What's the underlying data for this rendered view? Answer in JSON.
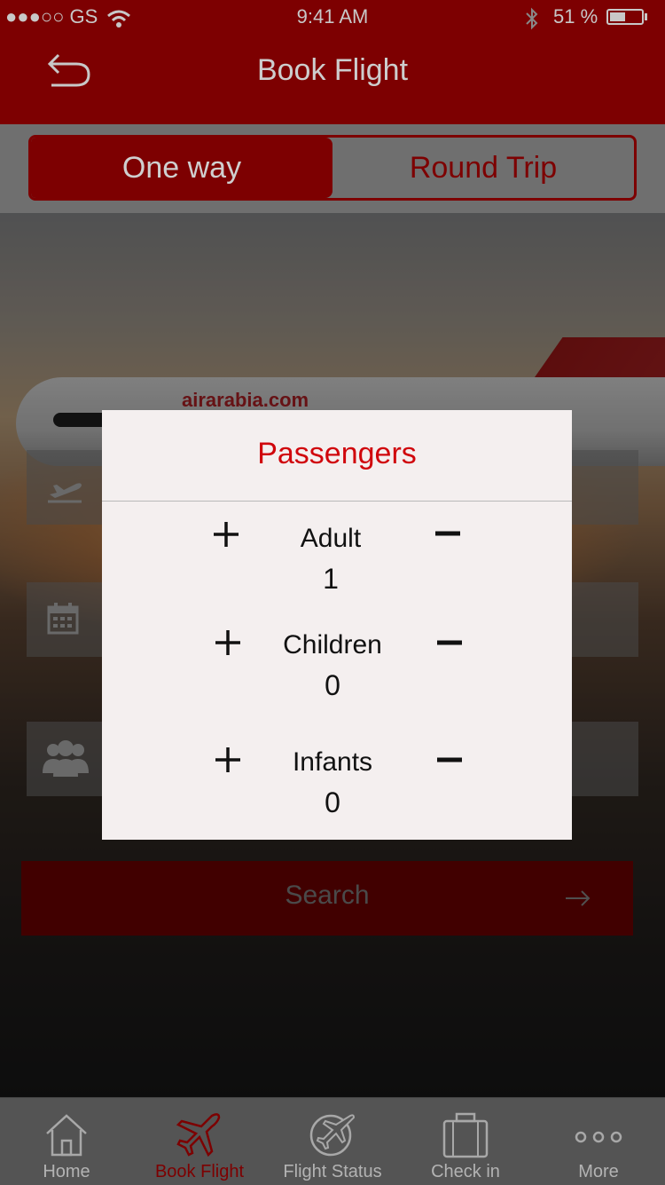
{
  "status_bar": {
    "carrier": "●●●○○ GS",
    "time": "9:41 AM",
    "battery": "51 %",
    "battery_level": 0.51
  },
  "header": {
    "title": "Book Flight"
  },
  "trip_type": {
    "options": [
      "One way",
      "Round Trip"
    ],
    "selected": "One way"
  },
  "background": {
    "plane_livery": "airarabia.com"
  },
  "form": {
    "search_label": "Search"
  },
  "passengers_modal": {
    "title": "Passengers",
    "rows": [
      {
        "label": "Adult",
        "count": "1"
      },
      {
        "label": "Children",
        "count": "0"
      },
      {
        "label": "Infants",
        "count": "0"
      }
    ]
  },
  "tabbar": {
    "items": [
      {
        "label": "Home",
        "icon": "home-icon"
      },
      {
        "label": "Book Flight",
        "icon": "airplane-icon"
      },
      {
        "label": "Flight Status",
        "icon": "flight-status-icon"
      },
      {
        "label": "Check in",
        "icon": "suitcase-icon"
      },
      {
        "label": "More",
        "icon": "more-dots-icon"
      }
    ],
    "active": "Book Flight"
  },
  "colors": {
    "brand": "#7d0001",
    "accent": "#d0060c",
    "modal_bg": "#f4efef"
  }
}
